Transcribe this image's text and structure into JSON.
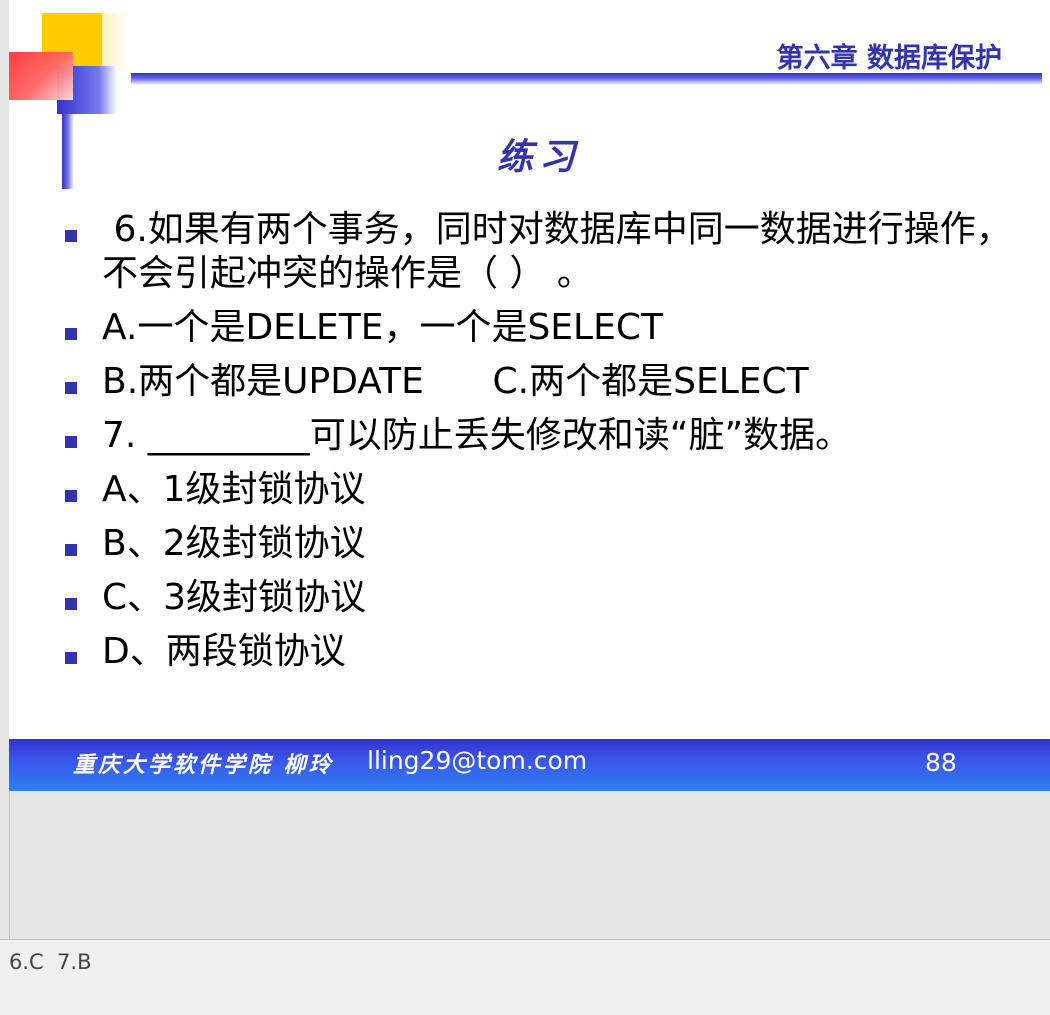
{
  "slide": {
    "chapter": "第六章 数据库保护",
    "title": "练习",
    "bullets": [
      " 6.如果有两个事务，同时对数据库中同一数据进行操作，不会引起冲突的操作是（ ） 。",
      "A.一个是DELETE，一个是SELECT",
      "B.两个都是UPDATE      C.两个都是SELECT",
      "7. _________可以防止丢失修改和读“脏”数据。",
      "A、1级封锁协议",
      "B、2级封锁协议",
      "C、3级封锁协议",
      "D、两段锁协议"
    ],
    "footer": {
      "school": "重庆大学软件学院  柳玲",
      "email": "lling29@tom.com",
      "page": "88"
    }
  },
  "notes": {
    "text": "6.C  7.B"
  },
  "colors": {
    "accent_blue": "#3333aa",
    "band_blue": "#2f7ff5",
    "yellow": "#ffcc00",
    "red": "#ff3333"
  }
}
